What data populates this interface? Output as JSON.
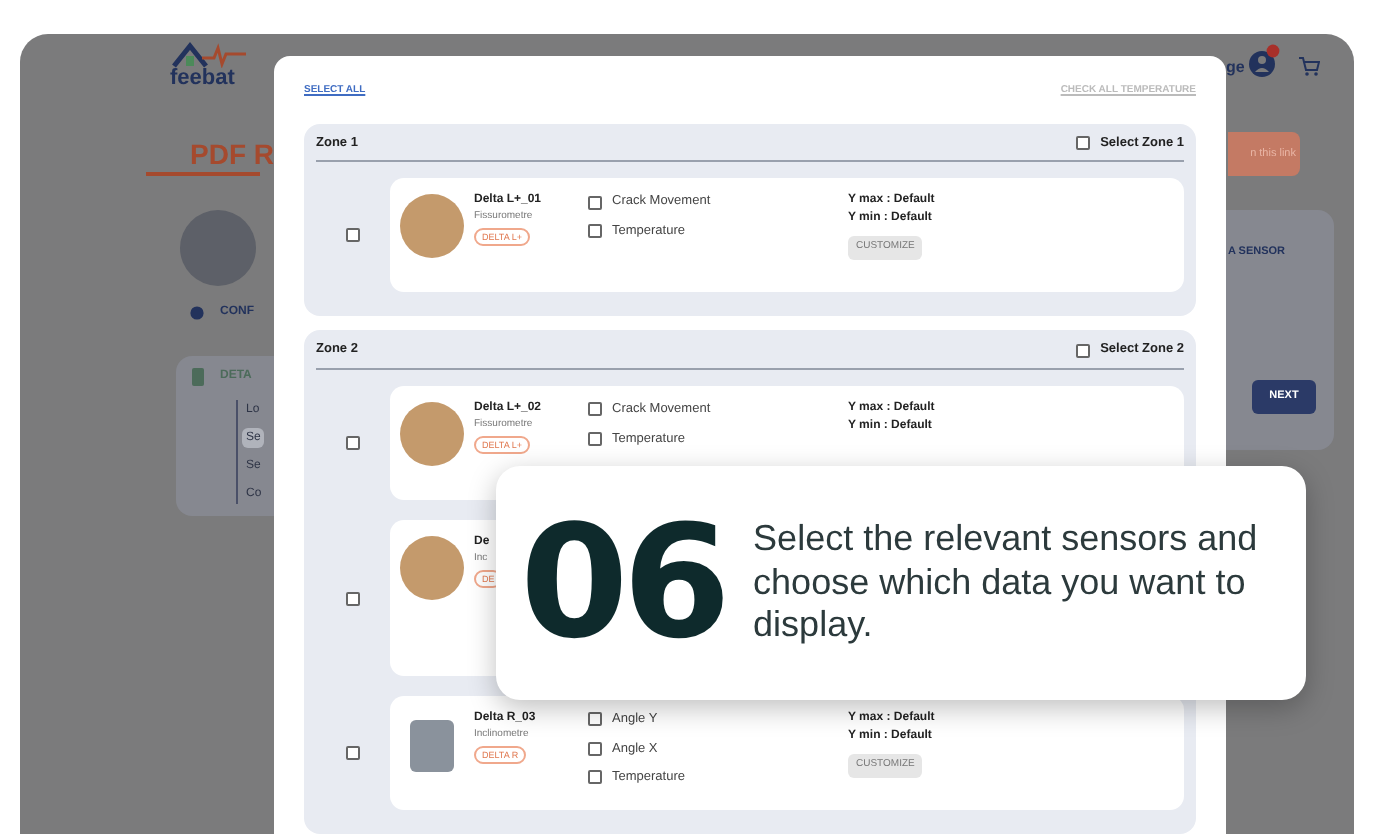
{
  "app": {
    "logo": "feebat",
    "title": "PDF R",
    "nav_item": "CONF",
    "details_title": "DETA",
    "details_items": [
      {
        "label": "Lo",
        "selected": false
      },
      {
        "label": "Se",
        "selected": true
      },
      {
        "label": "Se",
        "selected": false
      },
      {
        "label": "Co",
        "selected": false
      }
    ],
    "header_link": "ge",
    "link_button": "n this link",
    "sensor_label": "A SENSOR",
    "next_button": "NEXT"
  },
  "modal": {
    "select_all": "SELECT ALL",
    "check_all": "CHECK ALL TEMPERATURE",
    "zones": [
      {
        "title": "Zone 1",
        "select_label": "Select Zone 1",
        "checked": false,
        "sensors": [
          {
            "name": "Delta L+_01",
            "type": "Fissurometre",
            "tag": "DELTA L+",
            "checked": false,
            "kind": "round",
            "measures": [
              {
                "label": "Crack Movement",
                "checked": false
              },
              {
                "label": "Temperature",
                "checked": false
              }
            ],
            "ymax": "Y max : Default",
            "ymin": "Y min : Default",
            "button": "CUSTOMIZE"
          }
        ]
      },
      {
        "title": "Zone 2",
        "select_label": "Select Zone 2",
        "checked": false,
        "sensors": [
          {
            "name": "Delta L+_02",
            "type": "Fissurometre",
            "tag": "DELTA L+",
            "checked": false,
            "kind": "round",
            "measures": [
              {
                "label": "Crack Movement",
                "checked": false
              },
              {
                "label": "Temperature",
                "checked": false
              }
            ],
            "ymax": "Y max : Default",
            "ymin": "Y min : Default"
          },
          {
            "name": "De",
            "type": "Inc",
            "tag": "DE",
            "checked": false,
            "kind": "round"
          },
          {
            "name": "Delta R_03",
            "type": "Inclinometre",
            "tag": "DELTA R",
            "checked": false,
            "kind": "square",
            "measures": [
              {
                "label": "Angle Y",
                "checked": false
              },
              {
                "label": "Angle X",
                "checked": false
              },
              {
                "label": "Temperature",
                "checked": false
              }
            ],
            "ymax": "Y max : Default",
            "ymin": "Y min : Default",
            "button": "CUSTOMIZE"
          }
        ]
      }
    ]
  },
  "callout": {
    "number": "06",
    "text": "Select the relevant sensors and choose which data you want to display."
  }
}
